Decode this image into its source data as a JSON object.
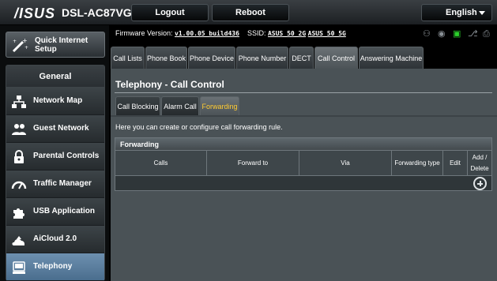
{
  "header": {
    "brand": "/ISUS",
    "model": "DSL-AC87VG",
    "logout_label": "Logout",
    "reboot_label": "Reboot",
    "language": "English"
  },
  "sidebar": {
    "quick_setup_label": "Quick Internet Setup",
    "section_title": "General",
    "items": [
      {
        "label": "Network Map",
        "icon": "network-map-icon"
      },
      {
        "label": "Guest Network",
        "icon": "guest-network-icon"
      },
      {
        "label": "Parental Controls",
        "icon": "lock-icon"
      },
      {
        "label": "Traffic Manager",
        "icon": "gauge-icon"
      },
      {
        "label": "USB Application",
        "icon": "puzzle-icon"
      },
      {
        "label": "AiCloud 2.0",
        "icon": "cloud-house-icon"
      },
      {
        "label": "Telephony",
        "icon": "telephone-icon",
        "active": true
      }
    ]
  },
  "status": {
    "firmware_label": "Firmware Version:",
    "firmware_version": "v1.00.05 build436",
    "ssid_label": "SSID:",
    "ssid_2g": "ASUS_50_2G",
    "ssid_5g": "ASUS_50_5G",
    "icons": [
      "users-icon",
      "globe-icon",
      "router-icon",
      "usb-icon",
      "printer-icon"
    ]
  },
  "tabs": [
    {
      "label": "Call Lists"
    },
    {
      "label": "Phone Book"
    },
    {
      "label": "Phone Device"
    },
    {
      "label": "Phone Number"
    },
    {
      "label": "DECT"
    },
    {
      "label": "Call Control",
      "active": true
    },
    {
      "label": "Answering Machine"
    }
  ],
  "panel": {
    "title": "Telephony - Call Control",
    "subtabs": [
      {
        "label": "Call Blocking"
      },
      {
        "label": "Alarm Call"
      },
      {
        "label": "Forwarding",
        "active": true
      }
    ],
    "description": "Here you can create or configure call forwarding rule.",
    "table": {
      "title": "Forwarding",
      "columns": [
        "Calls",
        "Forward to",
        "Via",
        "Forwarding type",
        "Edit",
        "Add / Delete"
      ]
    }
  },
  "colors": {
    "accent_active_tab_text": "#ffcc33",
    "sidebar_active": "#5a80a0",
    "green_status": "#2bd12b"
  }
}
